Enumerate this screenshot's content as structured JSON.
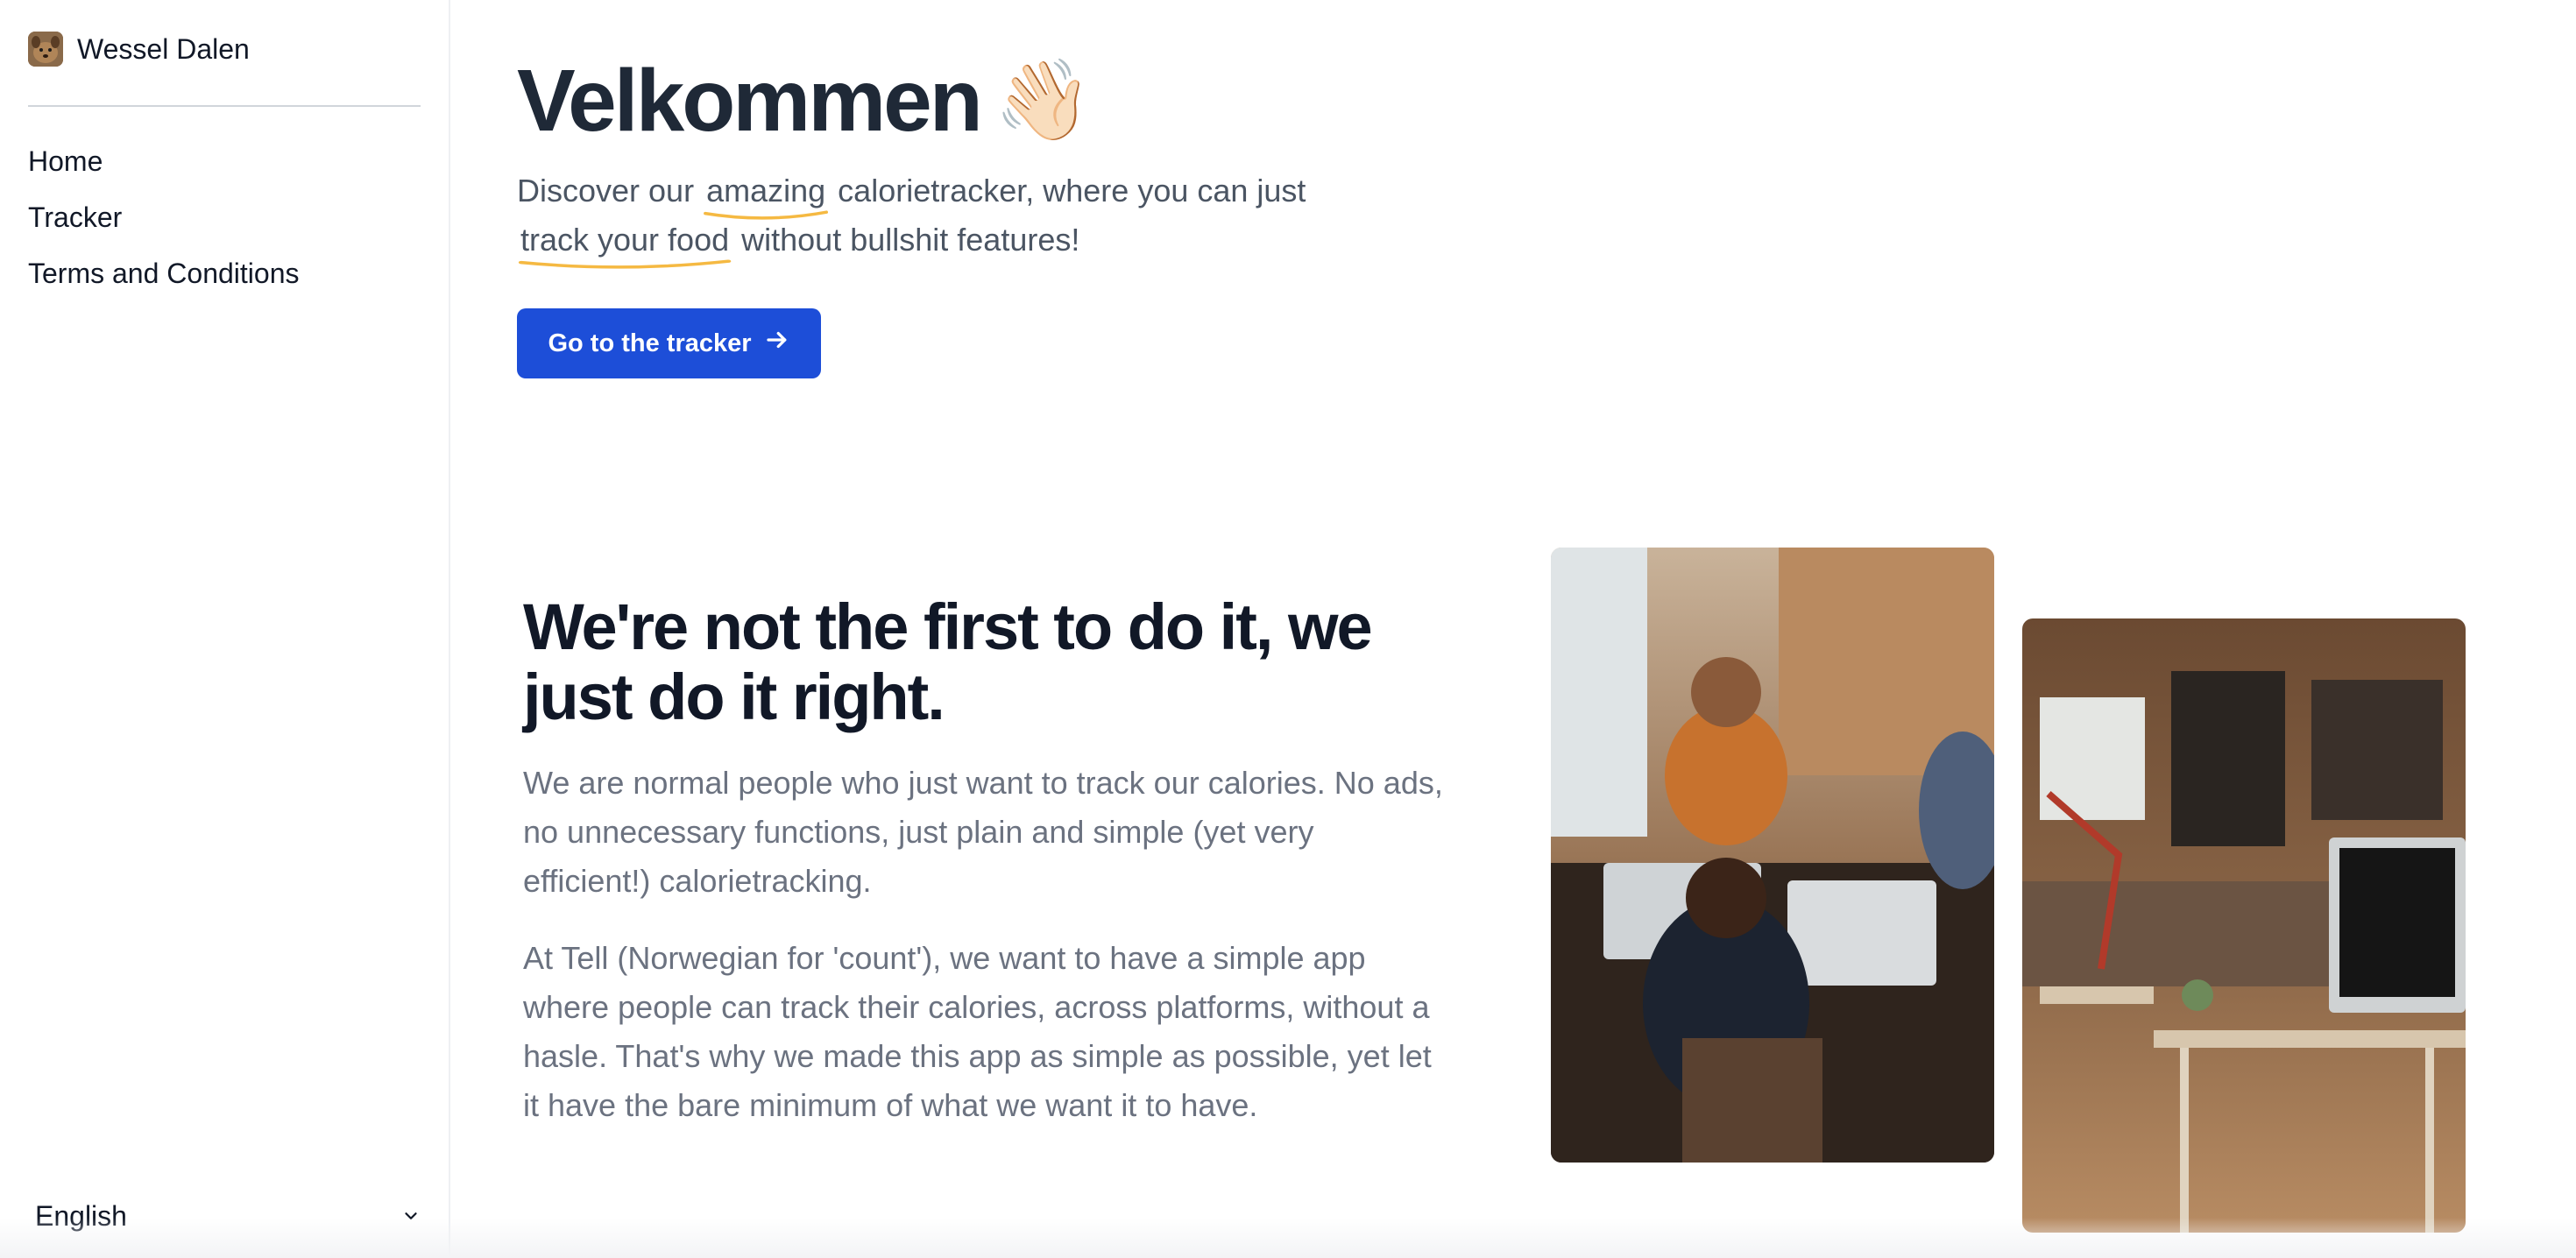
{
  "sidebar": {
    "brand": {
      "name": "Wessel Dalen",
      "avatar_icon": "dog-avatar-icon"
    },
    "nav": [
      {
        "label": "Home"
      },
      {
        "label": "Tracker"
      },
      {
        "label": "Terms and Conditions"
      }
    ],
    "language": {
      "selected": "English",
      "icon": "chevron-down-icon"
    }
  },
  "hero": {
    "title": "Velkommen",
    "emoji": "👋🏻",
    "subtitle_part1": "Discover our",
    "subtitle_highlight1": "amazing",
    "subtitle_part2": "calorietracker, where you can just",
    "subtitle_highlight2": "track your food",
    "subtitle_part3": "without bullshit features!",
    "cta_label": "Go to the tracker",
    "cta_icon": "arrow-right-icon"
  },
  "about": {
    "title": "We're not the first to do it, we just do it right.",
    "paragraph1": "We are normal people who just want to track our calories. No ads, no unnecessary functions, just plain and simple (yet very efficient!) calorietracking.",
    "paragraph2": "At Tell (Norwegian for 'count'), we want to have a simple app where people can track their calories, across platforms, without a hasle. That's why we made this app as simple as possible, yet let it have the bare minimum of what we want it to have."
  },
  "colors": {
    "primary": "#1d4ed8",
    "highlight_underline": "#f5b942",
    "text_dark": "#111827",
    "text_muted": "#6b7280"
  }
}
